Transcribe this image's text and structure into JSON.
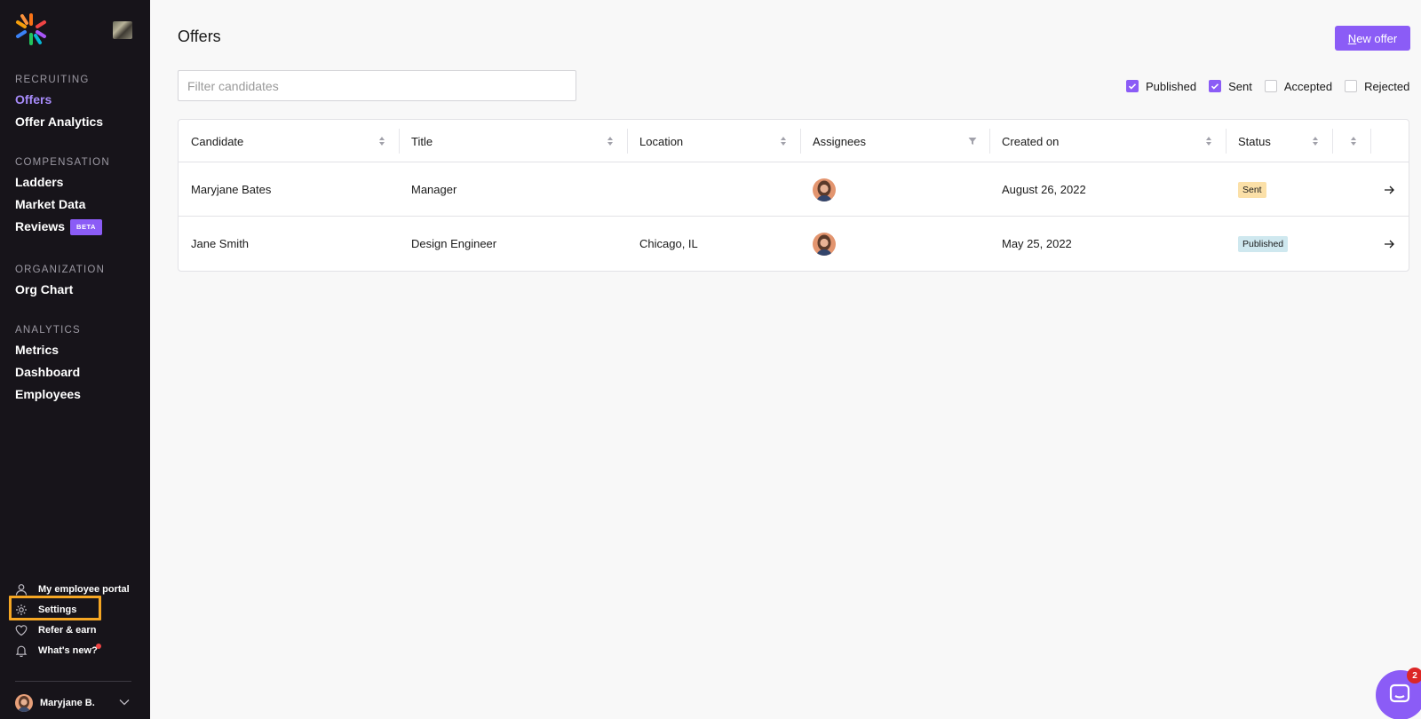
{
  "sidebar": {
    "sections": [
      {
        "heading": "Recruiting",
        "items": [
          {
            "label": "Offers",
            "active": true
          },
          {
            "label": "Offer Analytics",
            "active": false
          }
        ]
      },
      {
        "heading": "Compensation",
        "items": [
          {
            "label": "Ladders"
          },
          {
            "label": "Market Data"
          },
          {
            "label": "Reviews",
            "badge": "BETA"
          }
        ]
      },
      {
        "heading": "Organization",
        "items": [
          {
            "label": "Org Chart"
          }
        ]
      },
      {
        "heading": "Analytics",
        "items": [
          {
            "label": "Metrics"
          },
          {
            "label": "Dashboard"
          },
          {
            "label": "Employees"
          }
        ]
      }
    ],
    "bottom_links": [
      {
        "label": "My employee portal",
        "icon": "user-icon"
      },
      {
        "label": "Settings",
        "icon": "gear-icon"
      },
      {
        "label": "Refer & earn",
        "icon": "heart-icon"
      },
      {
        "label": "What's new?",
        "icon": "bell-icon"
      }
    ],
    "user": {
      "name": "Maryjane B."
    },
    "accent_color": "#a78bfa",
    "background_color": "#17141a"
  },
  "main": {
    "title": "Offers",
    "new_offer_button": {
      "underlined_letter": "N",
      "rest": "ew offer"
    },
    "filter": {
      "placeholder": "Filter candidates",
      "value": ""
    },
    "status_filters": [
      {
        "label": "Published",
        "checked": true
      },
      {
        "label": "Sent",
        "checked": true
      },
      {
        "label": "Accepted",
        "checked": false
      },
      {
        "label": "Rejected",
        "checked": false
      }
    ],
    "table": {
      "columns": [
        "Candidate",
        "Title",
        "Location",
        "Assignees",
        "Created on",
        "Status"
      ],
      "rows": [
        {
          "candidate": "Maryjane Bates",
          "title": "Manager",
          "location": "",
          "created_on": "August 26, 2022",
          "status": "Sent"
        },
        {
          "candidate": "Jane Smith",
          "title": "Design Engineer",
          "location": "Chicago, IL",
          "created_on": "May 25, 2022",
          "status": "Published"
        }
      ]
    }
  },
  "chat": {
    "unread_count": "2"
  },
  "colors": {
    "primary": "#8b5cf6",
    "sent_badge": "#fbe0a8",
    "published_badge": "#cfe8ef",
    "highlight": "#f5a623"
  }
}
